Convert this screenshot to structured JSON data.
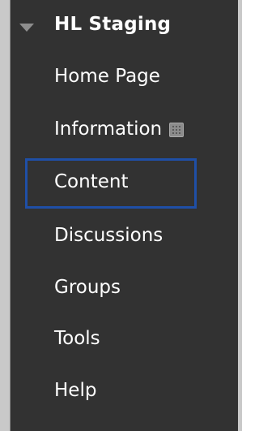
{
  "course": {
    "title": "HL Staging",
    "collapse_icon": "caret-down-icon"
  },
  "menu": {
    "items": [
      {
        "label": "Home Page"
      },
      {
        "label": "Information",
        "badge_icon": "hidden-from-students-icon"
      },
      {
        "label": "Content",
        "focused": true
      },
      {
        "label": "Discussions"
      },
      {
        "label": "Groups"
      },
      {
        "label": "Tools"
      },
      {
        "label": "Help"
      }
    ]
  },
  "colors": {
    "panel_background": "#323232",
    "text": "#ffffff",
    "focus_outline": "#1f4fa6",
    "caret": "#8e8e8e"
  }
}
